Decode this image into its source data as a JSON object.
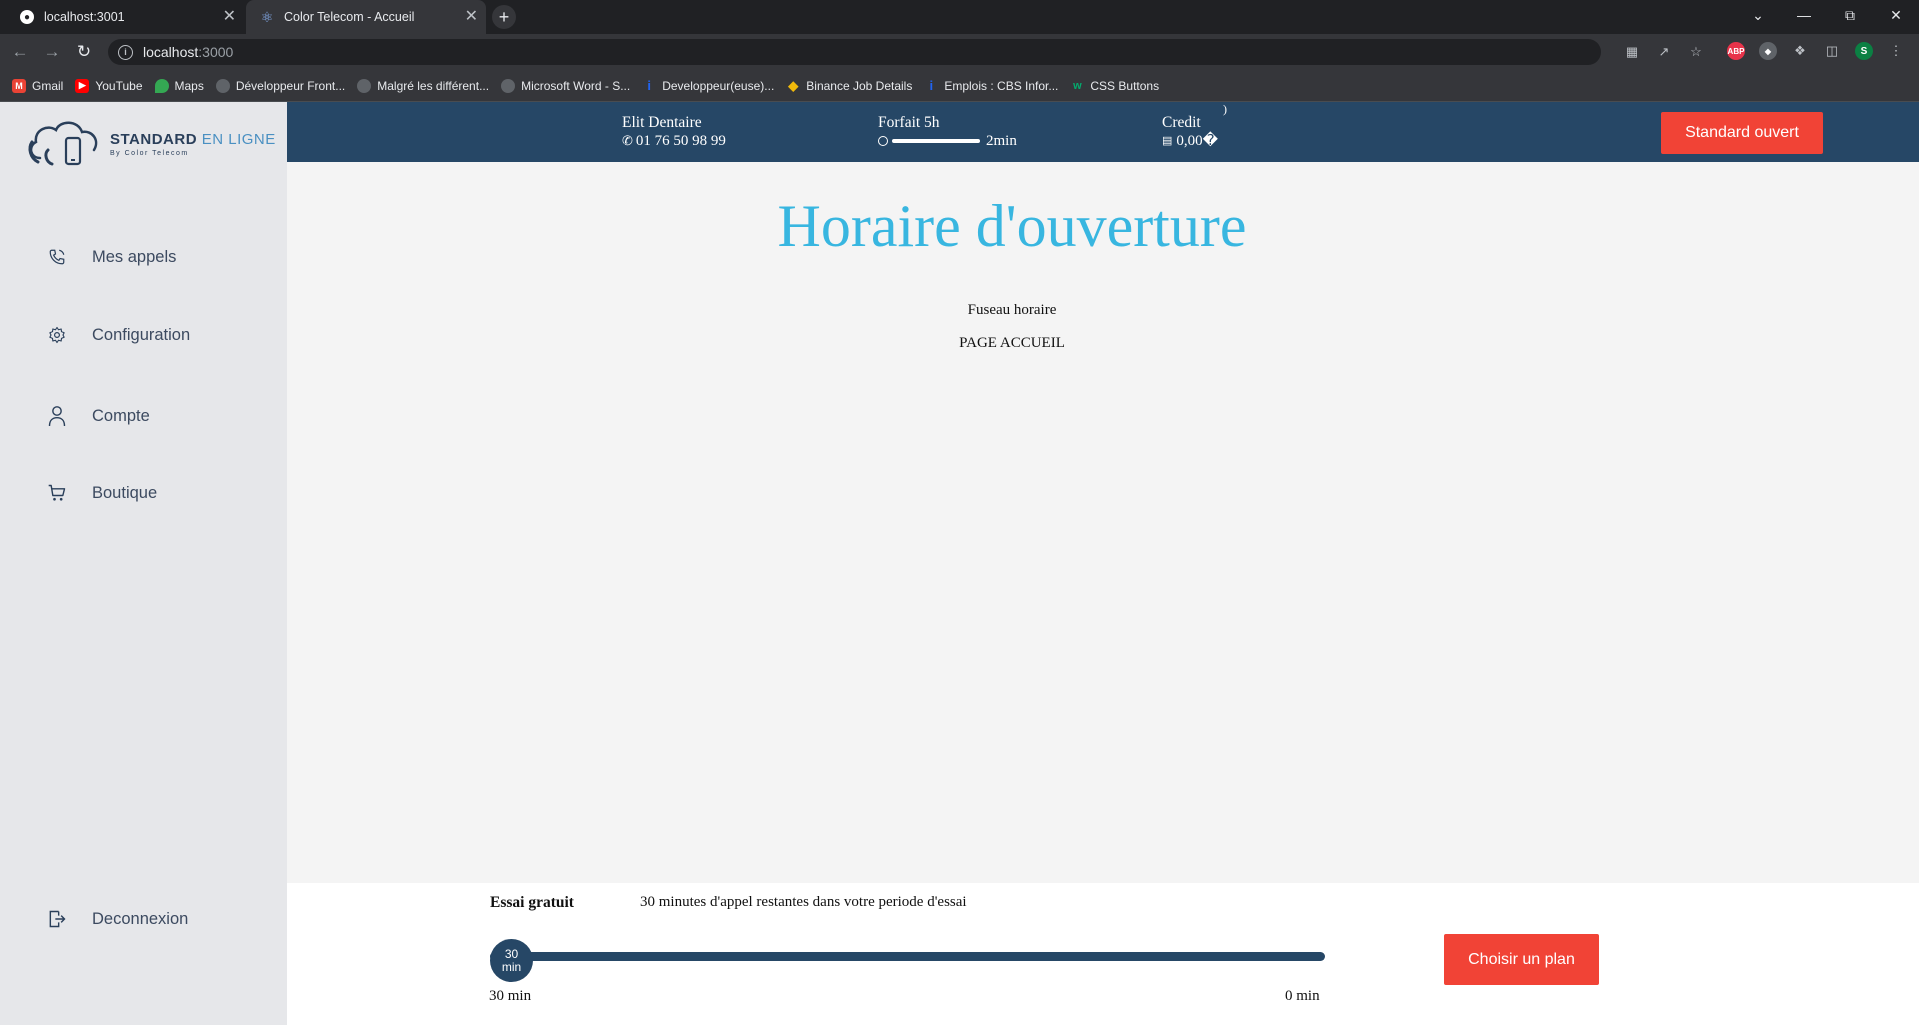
{
  "browser": {
    "tabs": [
      {
        "title": "localhost:3001",
        "active": false
      },
      {
        "title": "Color Telecom - Accueil",
        "active": true
      }
    ],
    "address": {
      "host": "localhost",
      "port": ":3000"
    },
    "bookmarks": [
      {
        "label": "Gmail",
        "icon": "gmail-icon",
        "color": "#ea4335"
      },
      {
        "label": "YouTube",
        "icon": "youtube-icon",
        "color": "#ff0000"
      },
      {
        "label": "Maps",
        "icon": "maps-icon",
        "color": "#34a853"
      },
      {
        "label": "Développeur Front...",
        "icon": "globe-icon",
        "color": "#5f6368"
      },
      {
        "label": "Malgré les différent...",
        "icon": "globe-icon",
        "color": "#5f6368"
      },
      {
        "label": "Microsoft Word - S...",
        "icon": "globe-icon",
        "color": "#5f6368"
      },
      {
        "label": "Developpeur(euse)...",
        "icon": "indeed-icon",
        "color": "#2164f3"
      },
      {
        "label": "Binance Job Details",
        "icon": "binance-icon",
        "color": "#f0b90b"
      },
      {
        "label": "Emplois : CBS Infor...",
        "icon": "indeed-icon",
        "color": "#2164f3"
      },
      {
        "label": "CSS Buttons",
        "icon": "w3-icon",
        "color": "#04aa6d"
      }
    ],
    "profile_initial": "S",
    "abp_label": "ABP"
  },
  "logo": {
    "brand": "STANDARD",
    "brand_light": " EN LIGNE",
    "tagline": "By Color Telecom"
  },
  "sidebar": {
    "items": [
      {
        "label": "Mes appels",
        "icon": "phone-icon"
      },
      {
        "label": "Configuration",
        "icon": "gear-icon"
      },
      {
        "label": "Compte",
        "icon": "user-icon"
      },
      {
        "label": "Boutique",
        "icon": "cart-icon"
      }
    ],
    "logout": {
      "label": "Deconnexion",
      "icon": "logout-icon"
    }
  },
  "topbar": {
    "company": "Elit Dentaire",
    "phone": "01 76 50 98 99",
    "plan_title": "Forfait 5h",
    "plan_remaining": "2min",
    "credit_title": "Credit",
    "credit_value": "0,00�",
    "stray_glyph": ")",
    "status_button": "Standard ouvert"
  },
  "main": {
    "title": "Horaire d'ouverture",
    "timezone_label": "Fuseau horaire",
    "page_label": "PAGE ACCUEIL"
  },
  "trial": {
    "title": "Essai gratuit",
    "description": "30 minutes d'appel restantes dans votre periode d'essai",
    "knob_value": "30",
    "knob_unit": "min",
    "start_label": "30 min",
    "end_label": "0 min",
    "remaining_fraction": 1.0,
    "plan_button": "Choisir un plan"
  },
  "colors": {
    "topbar_bg": "#264766",
    "accent_red": "#f14336",
    "title_blue": "#38b6e0",
    "sidebar_bg": "#e6e7ea"
  }
}
